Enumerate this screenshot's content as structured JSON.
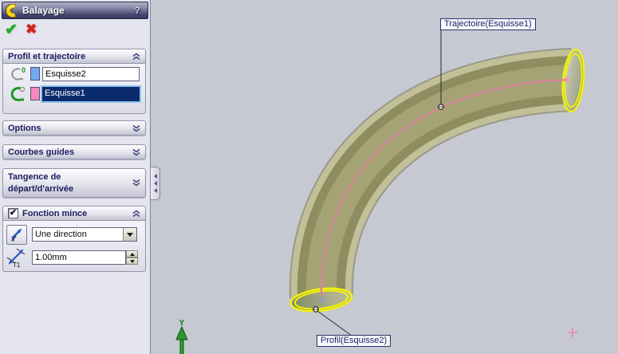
{
  "panel": {
    "title": "Balayage",
    "help_label": "?",
    "ok_glyph": "✔",
    "cancel_glyph": "✖",
    "groups": {
      "profil_trajectoire": {
        "title": "Profil et trajectoire",
        "profile_value": "Esquisse2",
        "path_value": "Esquisse1"
      },
      "options": {
        "title": "Options"
      },
      "courbes_guides": {
        "title": "Courbes guides"
      },
      "tangence": {
        "title": "Tangence de départ/d'arrivée"
      },
      "fonction_mince": {
        "title": "Fonction mince",
        "checkbox_checked": true,
        "checkbox_glyph": "✔",
        "direction_value": "Une direction",
        "thickness_value": "1.00mm",
        "thickness_icon_label": "T1"
      }
    }
  },
  "viewport": {
    "callouts": {
      "trajectory": "Trajectoire(Esquisse1)",
      "profile": "Profil(Esquisse2)"
    },
    "axis_y_label": "Y",
    "colors": {
      "background": "#c6c8d2",
      "tube_body": "#8e8d5f",
      "tube_edge_light": "#c2c098",
      "highlight_yellow": "#f4f400",
      "trajectory_pink": "#d48699",
      "selection_blue": "#0b2a6e",
      "swatch_blue": "#73a9f3",
      "swatch_pink": "#f787c0"
    }
  }
}
